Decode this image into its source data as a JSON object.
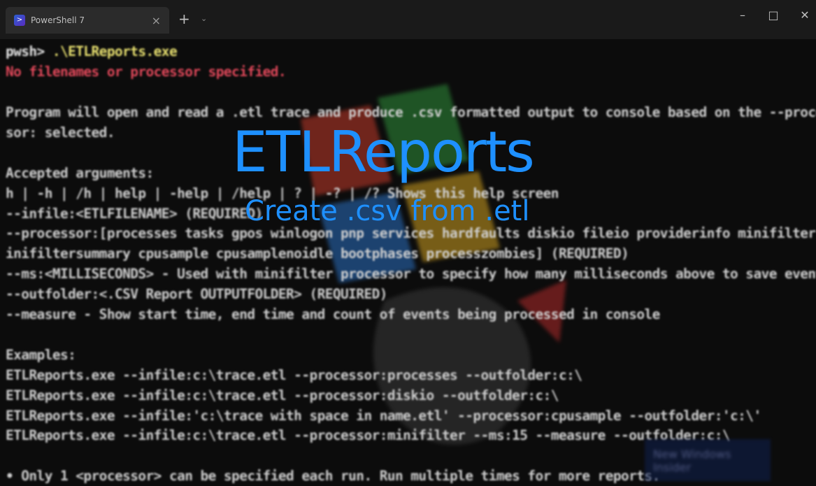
{
  "window": {
    "tab_title": "PowerShell 7",
    "tab_icon": "powershell-icon",
    "tab_close": "×",
    "new_tab": "+",
    "dropdown": "⌄",
    "minimize": "–",
    "maximize": "□",
    "close": "✕"
  },
  "overlay": {
    "title": "ETLReports",
    "subtitle": "Create .csv from .etl",
    "color": "#1e90ff"
  },
  "terminal": {
    "prompt": "pwsh>",
    "command": " .\\ETLReports.exe",
    "error": "No filenames or processor specified.",
    "lines": [
      "Program will open and read a .etl trace and produce .csv formatted output to console based on the --proces",
      "sor: selected.",
      "",
      "Accepted arguments:",
      "h | -h | /h | help | -help | /help | ? | -? | /? Shows this help screen",
      "--infile:<ETLFILENAME> (REQUIRED)",
      "--processor:[processes tasks gpos winlogon pnp services hardfaults diskio fileio providerinfo minifilter m",
      "inifiltersummary cpusample cpusamplenoidle bootphases processzombies] (REQUIRED)",
      "--ms:<MILLISECONDS> - Used with minifilter processor to specify how many milliseconds above to save events",
      "--outfolder:<.CSV Report OUTPUTFOLDER> (REQUIRED)",
      "--measure - Show start time, end time and count of events being processed in console",
      "",
      "Examples:",
      "ETLReports.exe --infile:c:\\trace.etl --processor:processes --outfolder:c:\\",
      "ETLReports.exe --infile:c:\\trace.etl --processor:diskio --outfolder:c:\\",
      "ETLReports.exe --infile:'c:\\trace with space in name.etl' --processor:cpusample --outfolder:'c:\\'",
      "ETLReports.exe --infile:c:\\trace.etl --processor:minifilter --ms:15 --measure --outfolder:c:\\",
      "",
      "• Only 1 <processor> can be specified each run. Run multiple times for more reports."
    ]
  },
  "watermark": {
    "text": "New Windows Insider"
  },
  "colors": {
    "background": "#0c0c0c",
    "titlebar": "#1a1a1a",
    "command": "#e8e070",
    "error": "#e0485a",
    "text": "#cfcfcf"
  }
}
